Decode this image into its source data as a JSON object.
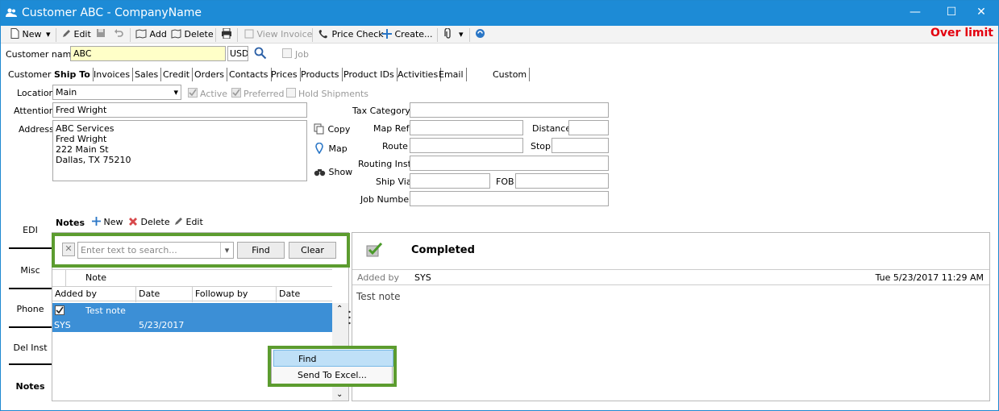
{
  "window": {
    "title": "Customer ABC - CompanyName",
    "minimize": "—",
    "maximize": "☐",
    "close": "✕"
  },
  "toolbar": {
    "new": "New",
    "edit": "Edit",
    "add": "Add",
    "delete": "Delete",
    "view_invoice": "View Invoice",
    "price_check": "Price Check",
    "create": "Create...",
    "status": "Over limit"
  },
  "customer": {
    "label": "Customer name",
    "value": "ABC",
    "currency": "USD",
    "job_label": "Job"
  },
  "tabs": [
    "Customer",
    "Ship To",
    "Invoices",
    "Sales",
    "Credit",
    "Orders",
    "Contacts",
    "Prices",
    "Products",
    "Product IDs",
    "Activities",
    "Email",
    "Custom"
  ],
  "shipto": {
    "location_label": "Location",
    "location": "Main",
    "active": "Active",
    "preferred": "Preferred",
    "hold": "Hold Shipments",
    "attention_label": "Attention",
    "attention": "Fred Wright",
    "address_label": "Address",
    "address": [
      "ABC Services",
      "Fred Wright",
      "222 Main St",
      "Dallas, TX 75210"
    ],
    "copy": "Copy",
    "map": "Map",
    "show": "Show",
    "tax_category": "Tax Category",
    "map_ref": "Map Ref",
    "distance": "Distance",
    "route": "Route",
    "stop": "Stop",
    "routing_inst": "Routing Inst",
    "ship_via": "Ship Via",
    "fob": "FOB",
    "job_number": "Job Number"
  },
  "left_tabs": [
    "EDI",
    "Misc",
    "Phone",
    "Del Inst",
    "Notes"
  ],
  "notes": {
    "title": "Notes",
    "new": "New",
    "delete": "Delete",
    "edit": "Edit",
    "search_placeholder": "Enter text to search...",
    "find": "Find",
    "clear": "Clear",
    "col_note": "Note",
    "col_added_by": "Added by",
    "col_date": "Date",
    "col_followup": "Followup by",
    "col_date2": "Date",
    "row": {
      "note": "Test note",
      "added_by": "SYS",
      "date": "5/23/2017"
    }
  },
  "detail": {
    "status": "Completed",
    "added_by_label": "Added by",
    "added_by": "SYS",
    "timestamp": "Tue 5/23/2017 11:29 AM",
    "body": "Test note"
  },
  "context_menu": {
    "find": "Find",
    "send_excel": "Send To Excel..."
  }
}
